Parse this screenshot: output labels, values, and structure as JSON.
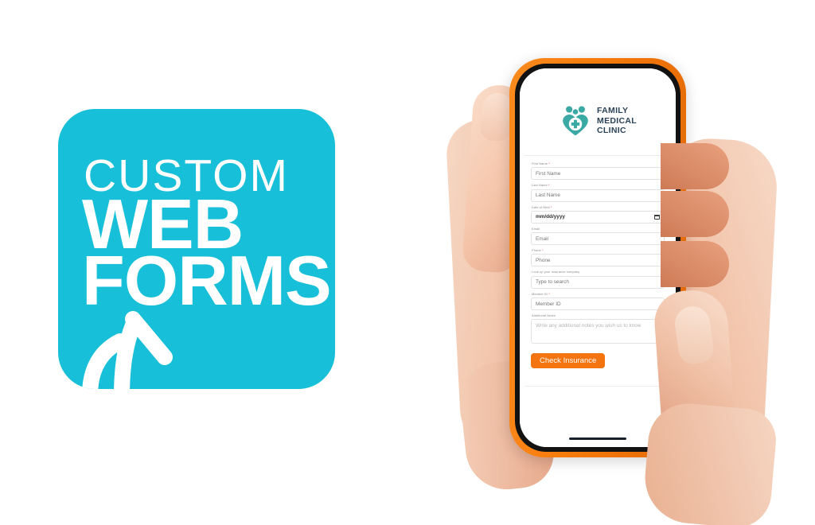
{
  "promo": {
    "line1": "CUSTOM",
    "line2": "WEB",
    "line3": "FORMS",
    "arrow_icon": "arrow-up-curved-icon",
    "background_color": "#17bfd8",
    "text_color": "#ffffff"
  },
  "device": {
    "case_color": "#f97f10",
    "frame_color": "#121212",
    "notch": "dynamic-island",
    "home_indicator": true
  },
  "clinic_app": {
    "logo": {
      "icon": "heart-family-cross-icon",
      "icon_color": "#3aa9a4",
      "name_line1": "FAMILY",
      "name_line2": "MEDICAL",
      "name_line3": "CLINIC",
      "text_color": "#2b4257"
    },
    "close_button_icon": "close-box-icon",
    "fields": [
      {
        "label": "First Name",
        "required": true,
        "placeholder": "First Name",
        "value": "",
        "type": "text"
      },
      {
        "label": "Last Name",
        "required": true,
        "placeholder": "Last Name",
        "value": "",
        "type": "text"
      },
      {
        "label": "Date of Birth",
        "required": true,
        "placeholder": "mm/dd/yyyy",
        "value": "mm/dd/yyyy",
        "type": "date"
      },
      {
        "label": "Email",
        "required": false,
        "placeholder": "Email",
        "value": "",
        "type": "email"
      },
      {
        "label": "Phone",
        "required": true,
        "placeholder": "Phone",
        "value": "",
        "type": "tel"
      },
      {
        "label": "Look up your insurance company",
        "required": false,
        "placeholder": "Type to search",
        "value": "",
        "type": "search"
      },
      {
        "label": "Member ID",
        "required": true,
        "placeholder": "Member ID",
        "value": "",
        "type": "text"
      },
      {
        "label": "Additional Notes",
        "required": false,
        "placeholder": "Write any additional notes you wish us to know",
        "value": "",
        "type": "textarea"
      }
    ],
    "submit_label": "Check Insurance",
    "submit_color": "#f4740f"
  }
}
